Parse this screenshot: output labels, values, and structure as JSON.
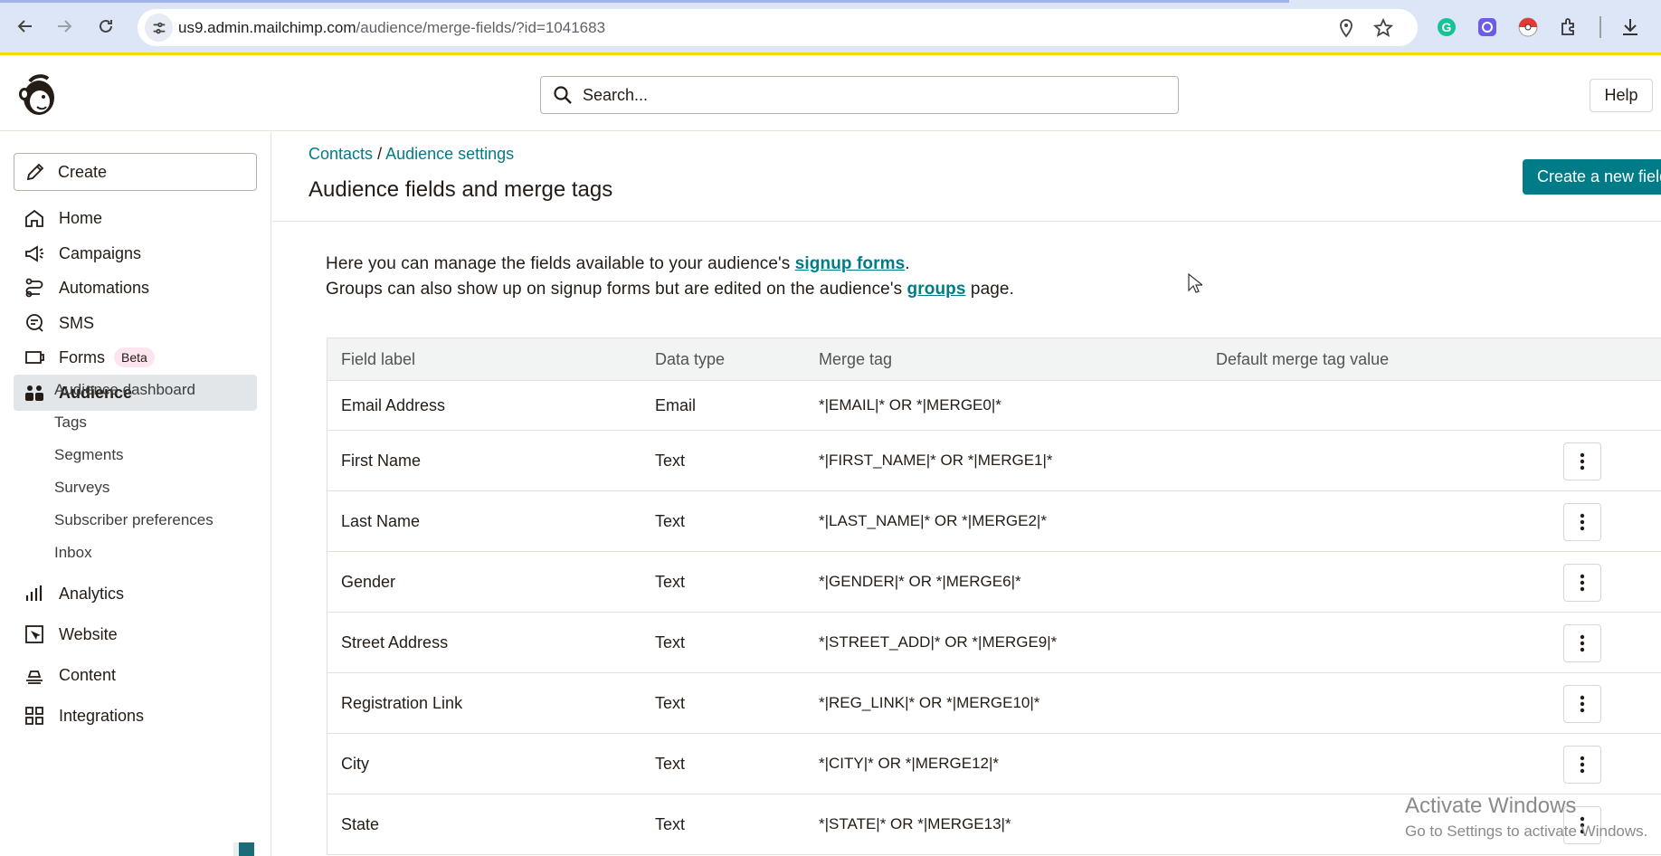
{
  "browser": {
    "url_host": "us9.admin.mailchimp.com",
    "url_path": "/audience/merge-fields/?id=1041683",
    "icons": [
      "back-icon",
      "forward-icon",
      "reload-icon",
      "site-info-icon",
      "location-icon",
      "star-icon",
      "grammarly-icon",
      "extension-icon",
      "pokeball-icon",
      "puzzle-icon",
      "download-icon"
    ]
  },
  "header": {
    "search_placeholder": "Search...",
    "help_label": "Help"
  },
  "sidebar": {
    "create_label": "Create",
    "items": [
      {
        "label": "Home",
        "icon": "home-icon"
      },
      {
        "label": "Campaigns",
        "icon": "megaphone-icon"
      },
      {
        "label": "Automations",
        "icon": "automations-icon"
      },
      {
        "label": "SMS",
        "icon": "sms-icon"
      },
      {
        "label": "Forms",
        "icon": "forms-icon",
        "badge": "Beta"
      },
      {
        "label": "Audience",
        "icon": "audience-icon",
        "active": true
      },
      {
        "label": "Analytics",
        "icon": "analytics-icon"
      },
      {
        "label": "Website",
        "icon": "website-icon"
      },
      {
        "label": "Content",
        "icon": "content-icon"
      },
      {
        "label": "Integrations",
        "icon": "integrations-icon"
      }
    ],
    "audience_sub": [
      "Audience dashboard",
      "Tags",
      "Segments",
      "Surveys",
      "Subscriber preferences",
      "Inbox"
    ]
  },
  "page": {
    "breadcrumb": {
      "contacts": "Contacts",
      "separator": "/",
      "settings": "Audience settings"
    },
    "title": "Audience fields and merge tags",
    "create_button": "Create a new field",
    "intro": {
      "line1_pre": "Here you can manage the fields available to your audience's ",
      "line1_link": "signup forms",
      "line1_post": ".",
      "line2_pre": "Groups can also show up on signup forms but are edited on the audience's ",
      "line2_link": "groups",
      "line2_post": " page."
    }
  },
  "table": {
    "headers": [
      "Field label",
      "Data type",
      "Merge tag",
      "Default merge tag value"
    ],
    "rows": [
      {
        "label": "Email Address",
        "type": "Email",
        "tag": "*|EMAIL|* OR *|MERGE0|*",
        "default": "",
        "menu": false
      },
      {
        "label": "First Name",
        "type": "Text",
        "tag": "*|FIRST_NAME|* OR *|MERGE1|*",
        "default": "",
        "menu": true
      },
      {
        "label": "Last Name",
        "type": "Text",
        "tag": "*|LAST_NAME|* OR *|MERGE2|*",
        "default": "",
        "menu": true
      },
      {
        "label": "Gender",
        "type": "Text",
        "tag": "*|GENDER|* OR *|MERGE6|*",
        "default": "",
        "menu": true
      },
      {
        "label": "Street Address",
        "type": "Text",
        "tag": "*|STREET_ADD|* OR *|MERGE9|*",
        "default": "",
        "menu": true
      },
      {
        "label": "Registration Link",
        "type": "Text",
        "tag": "*|REG_LINK|* OR *|MERGE10|*",
        "default": "",
        "menu": true
      },
      {
        "label": "City",
        "type": "Text",
        "tag": "*|CITY|* OR *|MERGE12|*",
        "default": "",
        "menu": true
      },
      {
        "label": "State",
        "type": "Text",
        "tag": "*|STATE|* OR *|MERGE13|*",
        "default": "",
        "menu": true
      }
    ]
  },
  "watermark": {
    "line1": "Activate Windows",
    "line2": "Go to Settings to activate Windows."
  },
  "colors": {
    "accent": "#007c89",
    "active_nav": "#e2e6e8",
    "beta_badge": "#fde5ef",
    "browser_bar": "#dde6f6",
    "highlight_line": "#f5d90a"
  }
}
